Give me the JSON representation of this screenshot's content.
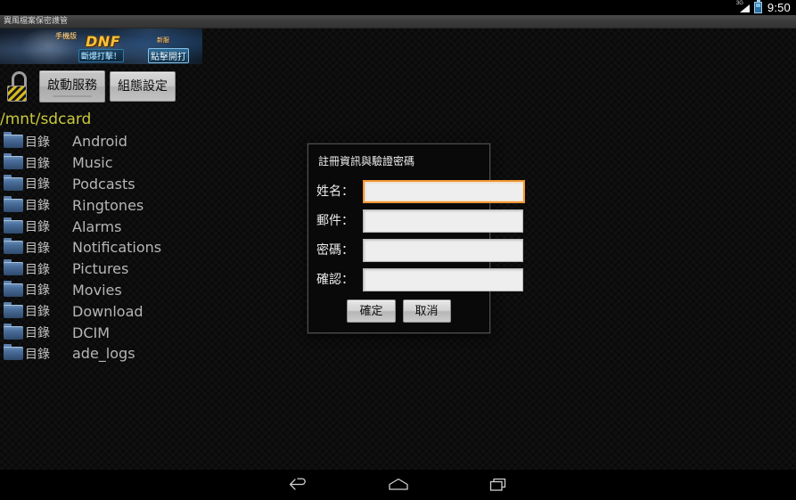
{
  "statusbar": {
    "network_label": "3G",
    "signal_icon": "signal-bars-icon",
    "battery_icon": "battery-icon",
    "clock": "9:50"
  },
  "titlebar": {
    "title": "異風檔案保密謢管"
  },
  "ad_banner": {
    "brand": "DNF",
    "tagline_mobile": "手機版",
    "tagline_sub": "斷爆打擊！",
    "cta_top": "新服",
    "cta": "點擊開打"
  },
  "toolbar": {
    "lock_icon": "open-padlock-icon",
    "start_service_label": "啟動服務",
    "config_label": "組態設定"
  },
  "browser": {
    "path": "/mnt/sdcard",
    "type_label": "目錄",
    "items": [
      {
        "type": "目錄",
        "name": "Android"
      },
      {
        "type": "目錄",
        "name": "Music"
      },
      {
        "type": "目錄",
        "name": "Podcasts"
      },
      {
        "type": "目錄",
        "name": "Ringtones"
      },
      {
        "type": "目錄",
        "name": "Alarms"
      },
      {
        "type": "目錄",
        "name": "Notifications"
      },
      {
        "type": "目錄",
        "name": "Pictures"
      },
      {
        "type": "目錄",
        "name": "Movies"
      },
      {
        "type": "目錄",
        "name": "Download"
      },
      {
        "type": "目錄",
        "name": "DCIM"
      },
      {
        "type": "目錄",
        "name": "ade_logs"
      }
    ]
  },
  "dialog": {
    "title": "註冊資訊與驗證密碼",
    "fields": [
      {
        "label": "姓名：",
        "value": "",
        "placeholder": ""
      },
      {
        "label": "郵件：",
        "value": "",
        "placeholder": ""
      },
      {
        "label": "密碼：",
        "value": "",
        "placeholder": ""
      },
      {
        "label": "確認：",
        "value": "",
        "placeholder": ""
      }
    ],
    "ok_label": "確定",
    "cancel_label": "取消"
  },
  "navbar": {
    "back_icon": "back-arrow-icon",
    "home_icon": "home-icon",
    "recents_icon": "recent-apps-icon"
  },
  "colors": {
    "path_yellow": "#c9c93d",
    "focus_orange": "#ef9536",
    "folder_blue": "#4a6e9b",
    "background": "#0a0a0a"
  }
}
